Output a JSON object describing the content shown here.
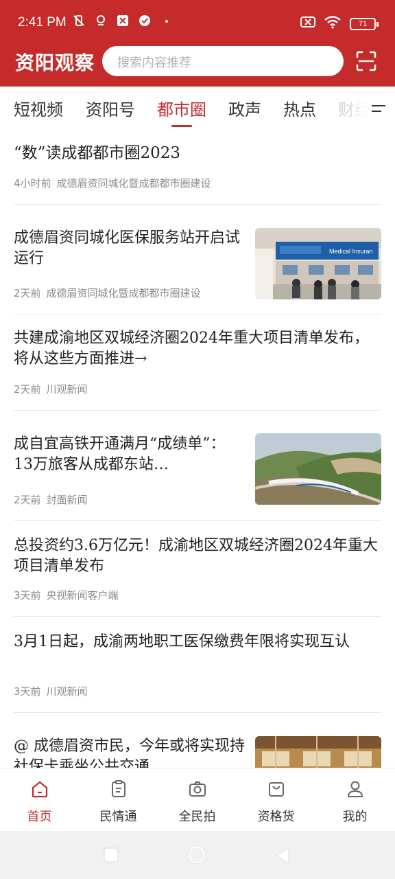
{
  "status_bar": {
    "time": "2:41 PM",
    "battery": "71"
  },
  "header": {
    "logo": "资阳观察",
    "search_placeholder": "搜索内容推荐"
  },
  "tabs": [
    {
      "label": "短视频"
    },
    {
      "label": "资阳号"
    },
    {
      "label": "都市圈",
      "active": true
    },
    {
      "label": "政声"
    },
    {
      "label": "热点"
    },
    {
      "label": "财经"
    }
  ],
  "news": [
    {
      "title": "“数”读成都都市圈2023",
      "time": "4小时前",
      "source": "成德眉资同城化暨成都都市圈建设"
    },
    {
      "title": "成德眉资同城化医保服务站开启试运行",
      "time": "2天前",
      "source": "成德眉资同城化暨成都都市圈建设",
      "thumb_text": "Medical Insuran"
    },
    {
      "title": "共建成渝地区双城经济圈2024年重大项目清单发布，将从这些方面推进→",
      "time": "2天前",
      "source": "川观新闻"
    },
    {
      "title": "成自宜高铁开通满月“成绩单”：13万旅客从成都东站…",
      "time": "2天前",
      "source": "封面新闻"
    },
    {
      "title": "总投资约3.6万亿元！成渝地区双城经济圈2024年重大项目清单发布",
      "time": "3天前",
      "source": "央视新闻客户端"
    },
    {
      "title": "3月1日起，成渝两地职工医保缴费年限将实现互认",
      "time": "3天前",
      "source": "川观新闻"
    },
    {
      "title": "@ 成德眉资市民，今年或将实现持社保卡乘坐公共交通"
    }
  ],
  "bottom_nav": [
    {
      "label": "首页",
      "icon": "home-icon",
      "active": true
    },
    {
      "label": "民情通",
      "icon": "clipboard-icon"
    },
    {
      "label": "全民拍",
      "icon": "camera-icon"
    },
    {
      "label": "资格货",
      "icon": "shopping-bag-icon"
    },
    {
      "label": "我的",
      "icon": "user-icon"
    }
  ],
  "colors": {
    "brand": "#c42b2a",
    "meta_text": "#8a8a8a"
  }
}
